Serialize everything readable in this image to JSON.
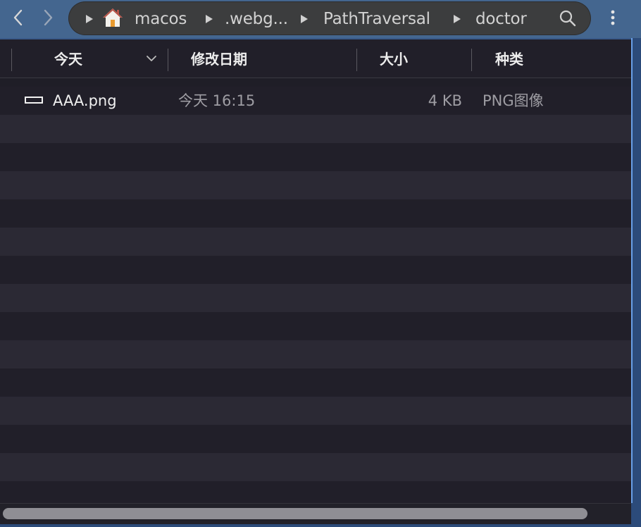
{
  "toolbar": {
    "back_icon": "chevron-left-icon",
    "forward_icon": "chevron-right-icon",
    "breadcrumbs": [
      {
        "label": "macos"
      },
      {
        "label": ".webg..."
      },
      {
        "label": "PathTraversal"
      },
      {
        "label": "doctor"
      }
    ],
    "home_icon": "home-icon",
    "search_icon": "search-icon",
    "more_icon": "vertical-ellipsis-icon"
  },
  "columns": {
    "group": "今天",
    "date": "修改日期",
    "size": "大小",
    "kind": "种类"
  },
  "files": [
    {
      "name": "AAA.png",
      "date": "今天 16:15",
      "size": "4 KB",
      "kind": "PNG图像"
    }
  ],
  "colors": {
    "toolbar": "#44668f",
    "pathbar": "#3c3d3e",
    "content_bg": "#1f1e27",
    "row_alt": "#2b2934",
    "accent_border": "#2c4b7a"
  }
}
